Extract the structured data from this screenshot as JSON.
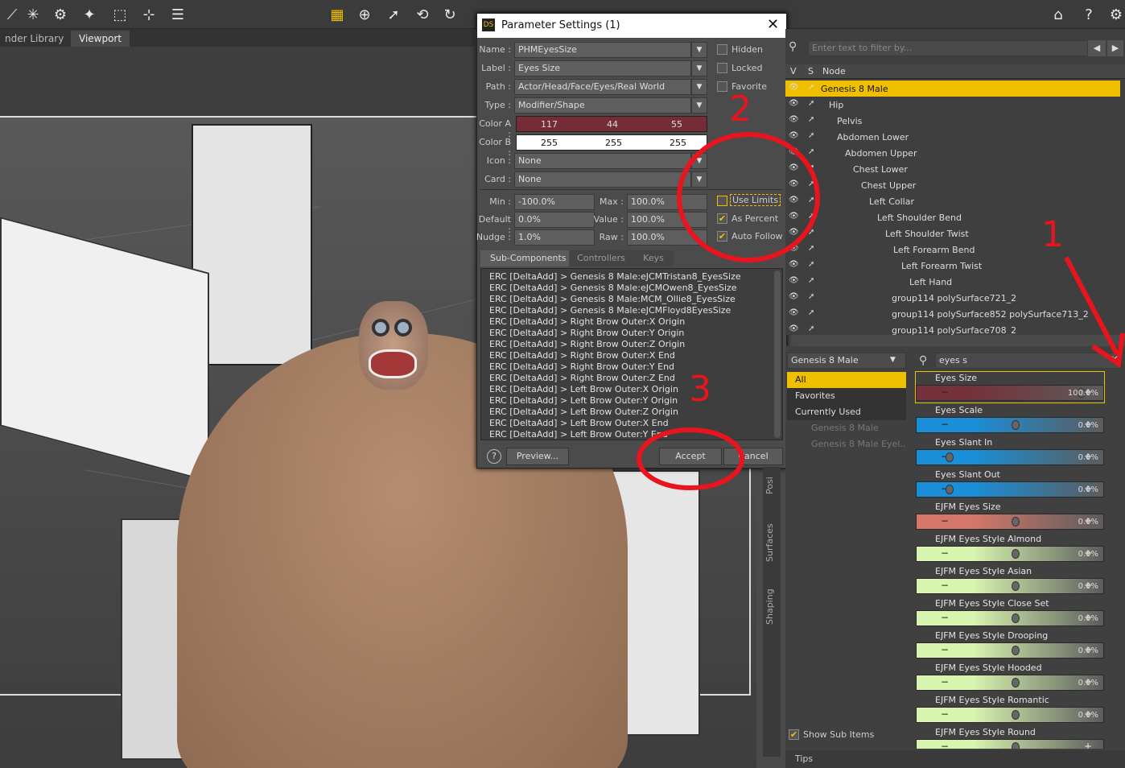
{
  "toolbar": {
    "icons": [
      "tool-icon",
      "spark-icon",
      "gear-tool-icon",
      "wand-icon",
      "node-icon",
      "joint-icon",
      "align-icon",
      "render-icon",
      "move-icon",
      "pointer-icon",
      "rotate-icon",
      "refresh-icon",
      "ds-home-icon",
      "help-icon",
      "gear-icon"
    ]
  },
  "tabs": [
    {
      "label": "nder Library"
    },
    {
      "label": "Viewport"
    }
  ],
  "dialog": {
    "title": "Parameter Settings (1)",
    "name_label": "Name :",
    "name_value": "PHMEyesSize",
    "label_label": "Label :",
    "label_value": "Eyes Size",
    "path_label": "Path :",
    "path_value": "Actor/Head/Face/Eyes/Real World",
    "type_label": "Type :",
    "type_value": "Modifier/Shape",
    "colora_label": "Color A :",
    "colora": [
      "117",
      "44",
      "55"
    ],
    "colorb_label": "Color B :",
    "colorb": [
      "255",
      "255",
      "255"
    ],
    "icon_label": "Icon :",
    "icon_value": "None",
    "card_label": "Card :",
    "card_value": "None",
    "hidden": "Hidden",
    "locked": "Locked",
    "favorite": "Favorite",
    "min_label": "Min :",
    "min_value": "-100.0%",
    "max_label": "Max :",
    "max_value": "100.0%",
    "default_label": "Default :",
    "default_value": "0.0%",
    "value_label": "Value :",
    "value_value": "100.0%",
    "nudge_label": "Nudge :",
    "nudge_value": "1.0%",
    "raw_label": "Raw :",
    "raw_value": "100.0%",
    "use_limits": "Use Limits",
    "as_percent": "As Percent",
    "auto_follow": "Auto Follow",
    "subtabs": [
      "Sub-Components",
      "Controllers",
      "Keys"
    ],
    "subcomponents": [
      "ERC [DeltaAdd] > Genesis 8 Male:eJCMTristan8_EyesSize",
      "ERC [DeltaAdd] > Genesis 8 Male:eJCMOwen8_EyesSize",
      "ERC [DeltaAdd] > Genesis 8 Male:MCM_Ollie8_EyesSize",
      "ERC [DeltaAdd] > Genesis 8 Male:eJCMFloyd8EyesSize",
      "ERC [DeltaAdd] > Right Brow Outer:X Origin",
      "ERC [DeltaAdd] > Right Brow Outer:Y Origin",
      "ERC [DeltaAdd] > Right Brow Outer:Z Origin",
      "ERC [DeltaAdd] > Right Brow Outer:X End",
      "ERC [DeltaAdd] > Right Brow Outer:Y End",
      "ERC [DeltaAdd] > Right Brow Outer:Z End",
      "ERC [DeltaAdd] > Left Brow Outer:X Origin",
      "ERC [DeltaAdd] > Left Brow Outer:Y Origin",
      "ERC [DeltaAdd] > Left Brow Outer:Z Origin",
      "ERC [DeltaAdd] > Left Brow Outer:X End",
      "ERC [DeltaAdd] > Left Brow Outer:Y End"
    ],
    "help": "?",
    "preview": "Preview...",
    "accept": "Accept",
    "cancel": "Cancel"
  },
  "scene": {
    "filter_placeholder": "Enter text to filter by...",
    "col_v": "V",
    "col_s": "S",
    "col_node": "Node",
    "nodes": [
      {
        "label": "Genesis 8 Male"
      },
      {
        "label": "Hip"
      },
      {
        "label": "Pelvis"
      },
      {
        "label": "Abdomen Lower"
      },
      {
        "label": "Abdomen Upper"
      },
      {
        "label": "Chest Lower"
      },
      {
        "label": "Chest Upper"
      },
      {
        "label": "Left Collar"
      },
      {
        "label": "Left Shoulder Bend"
      },
      {
        "label": "Left Shoulder Twist"
      },
      {
        "label": "Left Forearm Bend"
      },
      {
        "label": "Left Forearm Twist"
      },
      {
        "label": "Left Hand"
      },
      {
        "label": "group114 polySurface721_2"
      },
      {
        "label": "group114 polySurface852 polySurface713_2"
      },
      {
        "label": "group114 polySurface708_2"
      }
    ]
  },
  "params": {
    "figure": "Genesis 8 Male",
    "search": "eyes s",
    "groups": [
      {
        "label": "All"
      },
      {
        "label": "Favorites"
      },
      {
        "label": "Currently Used"
      },
      {
        "label": "Genesis 8 Male"
      },
      {
        "label": "Genesis 8 Male Eyel..."
      }
    ],
    "show_sub": "Show Sub Items",
    "tips": "Tips",
    "side_tabs": [
      "Posi",
      "Surfaces",
      "Shaping"
    ],
    "items": [
      {
        "name": "Eyes Size",
        "value": "100.0%",
        "level": 1.0,
        "color": "#75323a"
      },
      {
        "name": "Eyes Scale",
        "value": "0.0%",
        "level": 0.5,
        "color": "#1a8ed8"
      },
      {
        "name": "Eyes Slant In",
        "value": "0.0%",
        "level": 0.0,
        "color": "#1a8ed8"
      },
      {
        "name": "Eyes Slant Out",
        "value": "0.0%",
        "level": 0.0,
        "color": "#1a8ed8"
      },
      {
        "name": "EJFM Eyes Size",
        "value": "0.0%",
        "level": 0.5,
        "color": "#d4776a"
      },
      {
        "name": "EJFM Eyes Style Almond",
        "value": "0.0%",
        "level": 0.5,
        "color": "#d8f5b0"
      },
      {
        "name": "EJFM Eyes Style Asian",
        "value": "0.0%",
        "level": 0.5,
        "color": "#d8f5b0"
      },
      {
        "name": "EJFM Eyes Style Close Set",
        "value": "0.0%",
        "level": 0.5,
        "color": "#d8f5b0"
      },
      {
        "name": "EJFM Eyes Style Drooping",
        "value": "0.0%",
        "level": 0.5,
        "color": "#d8f5b0"
      },
      {
        "name": "EJFM Eyes Style Hooded",
        "value": "0.0%",
        "level": 0.5,
        "color": "#d8f5b0"
      },
      {
        "name": "EJFM Eyes Style Romantic",
        "value": "0.0%",
        "level": 0.5,
        "color": "#d8f5b0"
      },
      {
        "name": "EJFM Eyes Style Round",
        "value": "",
        "level": 0.5,
        "color": "#d8f5b0"
      }
    ]
  },
  "annotations": [
    "1",
    "2",
    "3"
  ]
}
